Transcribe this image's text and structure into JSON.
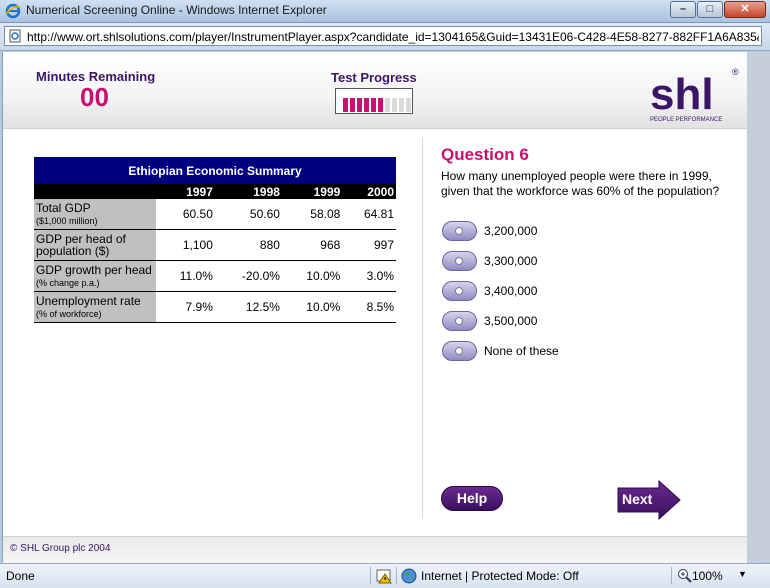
{
  "window": {
    "title": "Numerical Screening Online - Windows Internet Explorer",
    "url": "http://www.ort.shlsolutions.com/player/InstrumentPlayer.aspx?candidate_id=1304165&Guid=13431E06-C428-4E58-8277-882FF1A6A835&"
  },
  "header": {
    "minutes_label": "Minutes Remaining",
    "minutes_value": "00",
    "progress_label": "Test Progress",
    "progress": {
      "completed": 6,
      "total": 10
    },
    "logo_text": "shl",
    "logo_tagline": "PEOPLE PERFORMANCE",
    "logo_mark": "®"
  },
  "table": {
    "title": "Ethiopian Economic Summary",
    "years": [
      "1997",
      "1998",
      "1999",
      "2000"
    ],
    "rows": [
      {
        "label": "Total GDP",
        "sub": "($1,000 million)",
        "values": [
          "60.50",
          "50.60",
          "58.08",
          "64.81"
        ]
      },
      {
        "label": "GDP per head of population ($)",
        "sub": "",
        "values": [
          "1,100",
          "880",
          "968",
          "997"
        ]
      },
      {
        "label": "GDP growth per head",
        "sub": "(% change p.a.)",
        "values": [
          "11.0%",
          "-20.0%",
          "10.0%",
          "3.0%"
        ]
      },
      {
        "label": "Unemployment rate",
        "sub": "(% of workforce)",
        "values": [
          "7.9%",
          "12.5%",
          "10.0%",
          "8.5%"
        ]
      }
    ]
  },
  "question": {
    "title": "Question 6",
    "text": "How many unemployed people were there in 1999, given that the workforce was 60% of the population?",
    "options": [
      "3,200,000",
      "3,300,000",
      "3,400,000",
      "3,500,000",
      "None of these"
    ]
  },
  "buttons": {
    "help": "Help",
    "next": "Next"
  },
  "footer": {
    "copyright": "© SHL Group plc 2004"
  },
  "status": {
    "text": "Done",
    "zone": "Internet | Protected Mode: Off",
    "zoom": "100%"
  },
  "colors": {
    "brand_purple": "#3b1566",
    "brand_magenta": "#c8106e",
    "table_header": "#00007f"
  }
}
